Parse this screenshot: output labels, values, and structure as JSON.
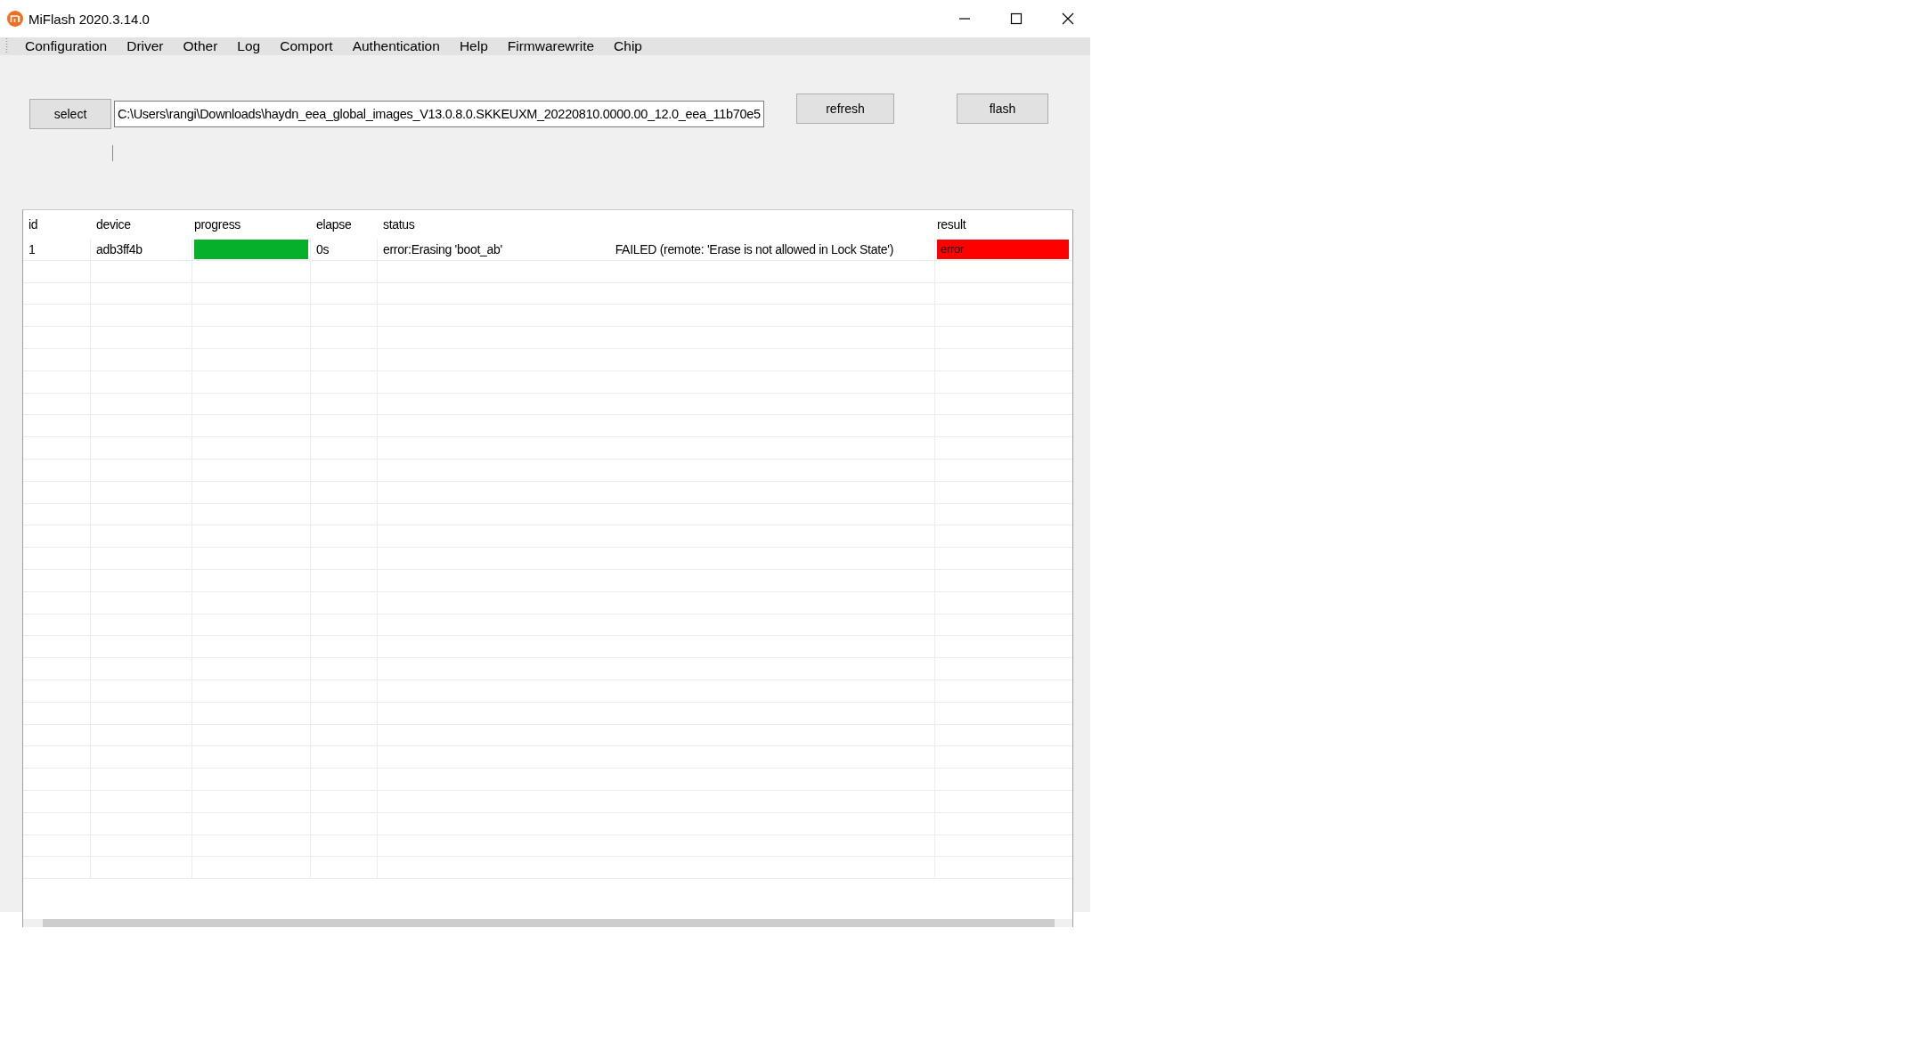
{
  "window": {
    "title": "MiFlash 2020.3.14.0"
  },
  "menu": [
    "Configuration",
    "Driver",
    "Other",
    "Log",
    "Comport",
    "Authentication",
    "Help",
    "Firmwarewrite",
    "Chip"
  ],
  "toolbar": {
    "select_button": "select",
    "path": "C:\\Users\\rangi\\Downloads\\haydn_eea_global_images_V13.0.8.0.SKKEUXM_20220810.0000.00_12.0_eea_11b70e5",
    "refresh_button": "refresh",
    "flash_button": "flash"
  },
  "table": {
    "columns": [
      "id",
      "device",
      "progress",
      "elapse",
      "status",
      "result"
    ],
    "rows": [
      {
        "id": "1",
        "device": "adb3ff4b",
        "progress": {
          "level": 1
        },
        "elapse": "0s",
        "status": "error:Erasing 'boot_ab'",
        "status_detail": "FAILED (remote: 'Erase is not allowed in Lock State')",
        "result": {
          "text": "error",
          "kind": "error"
        }
      }
    ]
  }
}
